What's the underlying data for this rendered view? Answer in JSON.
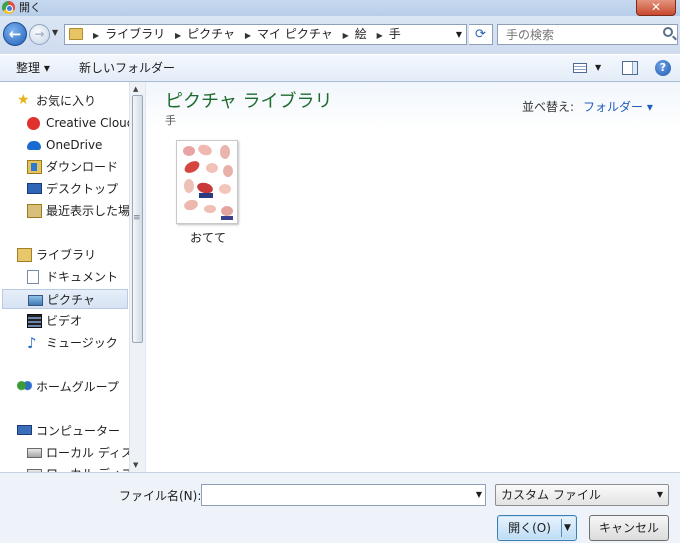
{
  "window": {
    "title": "開く",
    "close_label": "✕"
  },
  "nav": {
    "back_glyph": "←",
    "forward_glyph": "→",
    "breadcrumb": [
      "ライブラリ",
      "ピクチャ",
      "マイ ピクチャ",
      "絵",
      "手"
    ],
    "search_placeholder": "手の検索"
  },
  "commands": {
    "organize": "整理 ▾",
    "new_folder": "新しいフォルダー",
    "help": "?"
  },
  "sidebar": {
    "favorites_header": "お気に入り",
    "favorites": [
      "Creative Cloud",
      "OneDrive",
      "ダウンロード",
      "デスクトップ",
      "最近表示した場所"
    ],
    "libraries_header": "ライブラリ",
    "libraries": [
      "ドキュメント",
      "ピクチャ",
      "ビデオ",
      "ミュージック"
    ],
    "homegroup": "ホームグループ",
    "computer_header": "コンピューター",
    "computer": [
      "ローカル ディスク",
      "ローカル ディスク"
    ],
    "selected": "ピクチャ"
  },
  "content": {
    "library_title": "ピクチャ ライブラリ",
    "library_subtitle": "手",
    "arrange_label": "並べ替え:",
    "arrange_value": "フォルダー ▾",
    "files": [
      {
        "name": "おてて",
        "icon": "image-thumbnail"
      }
    ]
  },
  "footer": {
    "filename_label": "ファイル名(N):",
    "filename_value": "",
    "filetype_value": "カスタム ファイル",
    "open_label": "開く(O)",
    "cancel_label": "キャンセル"
  }
}
